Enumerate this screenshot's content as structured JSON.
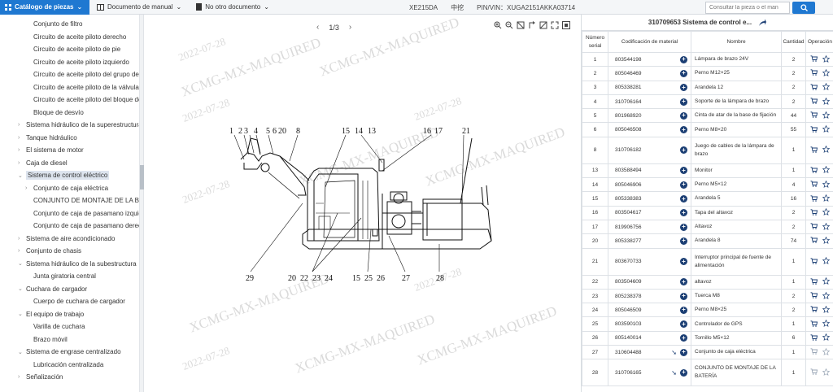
{
  "topbar": {
    "catalog": "Catálogo de piezas",
    "manual": "Documento de manual",
    "other_doc": "No otro documento",
    "model": "XE215DA",
    "brand": "中挖",
    "pin": "PIN/VIN：XUGA2151AKKA03714",
    "search_placeholder": "Consultar la pieza o el man"
  },
  "sidebar": {
    "items": [
      {
        "label": "Conjunto de filtro",
        "level": 2
      },
      {
        "label": "Circuito de aceite piloto derecho",
        "level": 2
      },
      {
        "label": "Circuito de aceite piloto de pie",
        "level": 2
      },
      {
        "label": "Circuito de aceite piloto izquierdo",
        "level": 2
      },
      {
        "label": "Circuito de aceite piloto del grupo de vá",
        "level": 2
      },
      {
        "label": "Circuito de aceite piloto de la válvula de",
        "level": 2
      },
      {
        "label": "Circuito de aceite piloto del bloque de f",
        "level": 2
      },
      {
        "label": "Bloque de desvío",
        "level": 2
      },
      {
        "label": "Sistema hidráulico de la superestructura",
        "level": 0,
        "chev": "›"
      },
      {
        "label": "Tanque hidráulico",
        "level": 0,
        "chev": "›"
      },
      {
        "label": "El sistema de motor",
        "level": 0,
        "chev": "›"
      },
      {
        "label": "Caja de diesel",
        "level": 0,
        "chev": "›"
      },
      {
        "label": "Sistema de control eléctrico",
        "level": 0,
        "chev": "⌄",
        "selected": true
      },
      {
        "label": "Conjunto de caja eléctrica",
        "level": 1,
        "chev": "›"
      },
      {
        "label": "CONJUNTO DE MONTAJE DE LA BAT",
        "level": 2
      },
      {
        "label": "Conjunto de caja de pasamano izquie",
        "level": 2
      },
      {
        "label": "Conjunto de caja de pasamano derech",
        "level": 2
      },
      {
        "label": "Sistema de aire acondicionado",
        "level": 0,
        "chev": "›"
      },
      {
        "label": "Conjunto de chasis",
        "level": 0,
        "chev": "›"
      },
      {
        "label": "Sistema hidráulico de la subestructura",
        "level": 0,
        "chev": "⌄"
      },
      {
        "label": "Junta giratoria central",
        "level": 2
      },
      {
        "label": "Cuchara de cargador",
        "level": 0,
        "chev": "⌄"
      },
      {
        "label": "Cuerpo de cuchara de cargador",
        "level": 2
      },
      {
        "label": "El equipo de trabajo",
        "level": 0,
        "chev": "⌄"
      },
      {
        "label": "Varilla de cuchara",
        "level": 2
      },
      {
        "label": "Brazo móvil",
        "level": 2
      },
      {
        "label": "Sistema de engrase centralizado",
        "level": 0,
        "chev": "⌄"
      },
      {
        "label": "Lubricación centralizada",
        "level": 2
      },
      {
        "label": "Señalización",
        "level": 0,
        "chev": "›"
      }
    ]
  },
  "diagram": {
    "page": "1/3",
    "watermark": "XCMG-MX-MAQUIRED",
    "date_watermark": "2022-07-28",
    "callouts_top": [
      "1",
      "2",
      "3",
      "4",
      "5",
      "6",
      "20",
      "8",
      "15",
      "14",
      "13",
      "16",
      "17",
      "21"
    ],
    "callouts_bottom": [
      "29",
      "20",
      "22",
      "23",
      "24",
      "15",
      "25",
      "26",
      "27",
      "28"
    ]
  },
  "parts": {
    "title": "310709653 Sistema de control e...",
    "headers": [
      "Número serial",
      "Codificación de material",
      "Nombre",
      "Cantidad",
      "Operación"
    ],
    "rows": [
      {
        "n": "1",
        "code": "803544198",
        "name": "Lámpara de brazo 24V",
        "qty": "2"
      },
      {
        "n": "2",
        "code": "805046469",
        "name": "Perno M12×25",
        "qty": "2"
      },
      {
        "n": "3",
        "code": "805338281",
        "name": "Arandela 12",
        "qty": "2"
      },
      {
        "n": "4",
        "code": "310706164",
        "name": "Soporte de la lámpara de brazo",
        "qty": "2"
      },
      {
        "n": "5",
        "code": "801968920",
        "name": "Cinta de atar de la base de fijación",
        "qty": "44"
      },
      {
        "n": "6",
        "code": "805046508",
        "name": "Perno M8×20",
        "qty": "55"
      },
      {
        "n": "8",
        "code": "310706182",
        "name": "Juego de cables de la lámpara de brazo",
        "qty": "1",
        "tall": true
      },
      {
        "n": "13",
        "code": "803588494",
        "name": "Monitor",
        "qty": "1"
      },
      {
        "n": "14",
        "code": "805046906",
        "name": "Perno M5×12",
        "qty": "4"
      },
      {
        "n": "15",
        "code": "805338383",
        "name": "Arandela 5",
        "qty": "16"
      },
      {
        "n": "16",
        "code": "803504617",
        "name": "Tapa del altavoz",
        "qty": "2"
      },
      {
        "n": "17",
        "code": "819906756",
        "name": "Altavoz",
        "qty": "2"
      },
      {
        "n": "20",
        "code": "805338277",
        "name": "Arandela 8",
        "qty": "74"
      },
      {
        "n": "21",
        "code": "803670733",
        "name": "Interruptor principal de fuente de alimentación",
        "qty": "1",
        "tall": true
      },
      {
        "n": "22",
        "code": "803504609",
        "name": "altavoz",
        "qty": "1"
      },
      {
        "n": "23",
        "code": "805238378",
        "name": "Tuerca M8",
        "qty": "2"
      },
      {
        "n": "24",
        "code": "805046509",
        "name": "Perno M8×25",
        "qty": "2"
      },
      {
        "n": "25",
        "code": "803590103",
        "name": "Controlador de GPS",
        "qty": "1"
      },
      {
        "n": "26",
        "code": "805140014",
        "name": "Tornillo M5×12",
        "qty": "6"
      },
      {
        "n": "27",
        "code": "310604488",
        "name": "Conjunto de caja eléctrica",
        "qty": "1",
        "arrow": true,
        "dim": true
      },
      {
        "n": "28",
        "code": "310706165",
        "name": "CONJUNTO DE MONTAJE DE LA BATERÍA",
        "qty": "1",
        "arrow": true,
        "dim": true,
        "tall": true
      }
    ]
  },
  "colors": {
    "accent": "#1f78d1",
    "navy": "#1c3f74"
  }
}
